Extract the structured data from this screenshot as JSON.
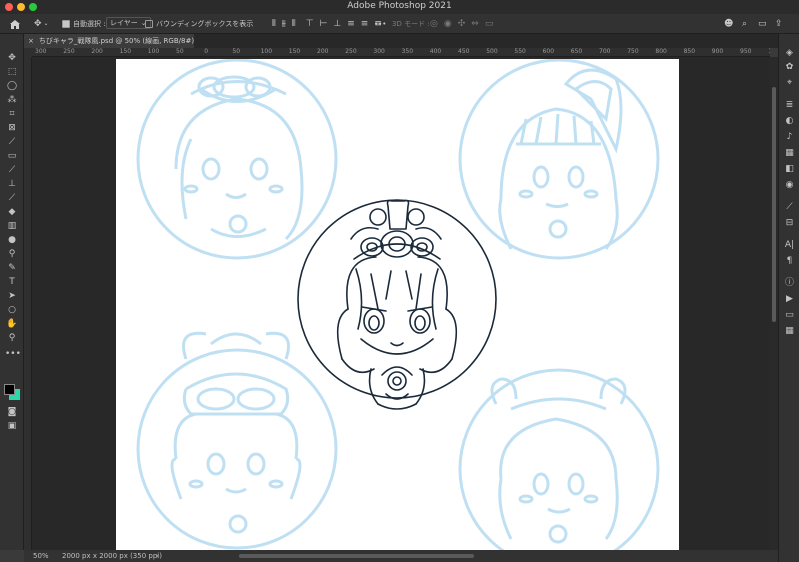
{
  "window": {
    "title": "Adobe Photoshop 2021"
  },
  "options_bar": {
    "home_icon": "home-icon",
    "move_icon": "move-icon",
    "auto_select_label": "自動選択 :",
    "auto_select_checked": true,
    "auto_select_target": "レイヤー",
    "bounding_box_label": "バウンディングボックスを表示",
    "bounding_box_checked": false,
    "more_label": "•••",
    "mode_3d_label": "3D モード :"
  },
  "document_tab": {
    "title": "ちびキャラ_戦隊風.psd @ 50% (線画, RGB/8#)",
    "close_label": "×"
  },
  "ruler_ticks": [
    "300",
    "250",
    "200",
    "150",
    "100",
    "50",
    "0",
    "50",
    "100",
    "150",
    "200",
    "250",
    "300",
    "350",
    "400",
    "450",
    "500",
    "550",
    "600",
    "650",
    "700",
    "750",
    "800",
    "850",
    "900",
    "950",
    "1000",
    "1050",
    "1100",
    "1150",
    "1200",
    "1250",
    "1300",
    "1350"
  ],
  "status_bar": {
    "zoom": "50%",
    "doc_info": "2000 px x 2000 px (350 ppi)",
    "arrow": "›"
  },
  "colors": {
    "foreground": "#000000",
    "background": "#2bd9a8",
    "line_art": "#1b2a3a",
    "sketch": "#bfe0f2"
  }
}
